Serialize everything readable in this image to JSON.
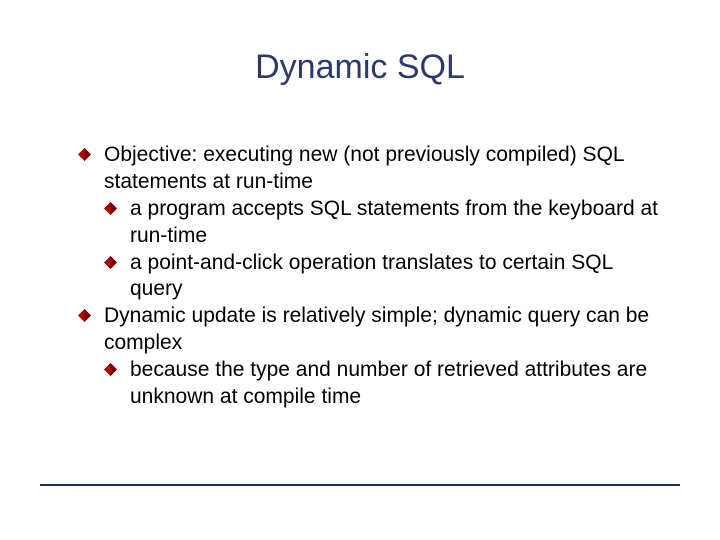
{
  "title": "Dynamic SQL",
  "points": {
    "p1": "Objective: executing new (not previously compiled) SQL statements at run-time",
    "p1a": "a program accepts SQL statements from the keyboard at run-time",
    "p1b": "a point-and-click operation translates to certain SQL query",
    "p2": "Dynamic update is relatively simple; dynamic query can be complex",
    "p2a": "because the type and number of retrieved attributes are unknown at compile time"
  }
}
